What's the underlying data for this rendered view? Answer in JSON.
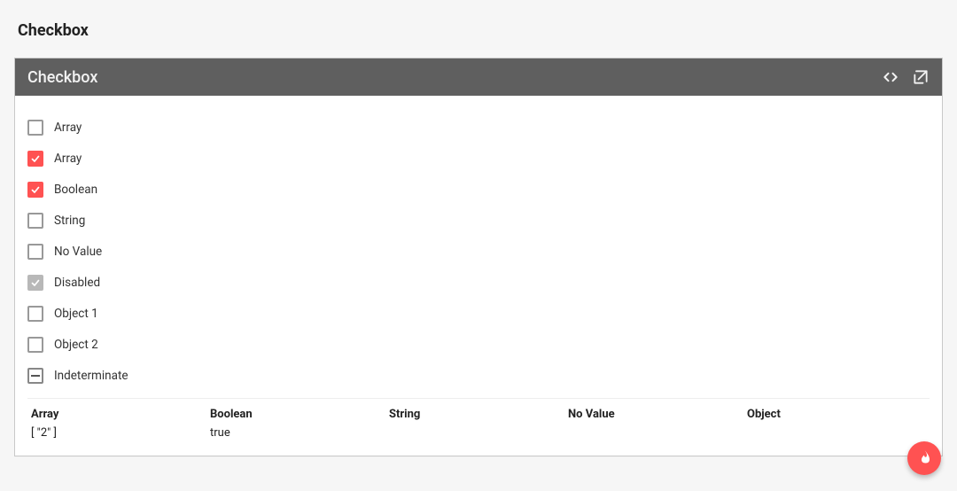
{
  "page": {
    "title": "Checkbox"
  },
  "card": {
    "title": "Checkbox"
  },
  "rows": [
    {
      "label": "Array",
      "state": "unchecked"
    },
    {
      "label": "Array",
      "state": "checked"
    },
    {
      "label": "Boolean",
      "state": "checked"
    },
    {
      "label": "String",
      "state": "unchecked"
    },
    {
      "label": "No Value",
      "state": "unchecked"
    },
    {
      "label": "Disabled",
      "state": "disabled-checked"
    },
    {
      "label": "Object 1",
      "state": "unchecked"
    },
    {
      "label": "Object 2",
      "state": "unchecked"
    },
    {
      "label": "Indeterminate",
      "state": "indeterminate"
    }
  ],
  "results": {
    "array": {
      "head": "Array",
      "value": "[ \"2\" ]"
    },
    "boolean": {
      "head": "Boolean",
      "value": "true"
    },
    "string": {
      "head": "String",
      "value": ""
    },
    "novalue": {
      "head": "No Value",
      "value": ""
    },
    "object": {
      "head": "Object",
      "value": ""
    }
  },
  "colors": {
    "accent": "#ff5252",
    "header_bg": "#5f5f5f"
  }
}
